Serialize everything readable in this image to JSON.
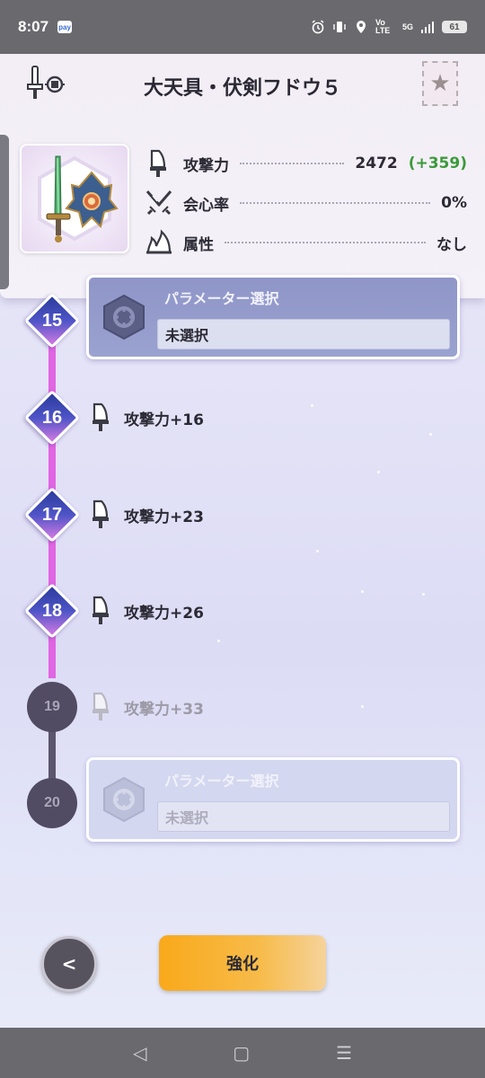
{
  "status_bar": {
    "time": "8:07",
    "app_badge": "pay",
    "network": "Vo LTE",
    "signal": "5G",
    "battery": "61"
  },
  "header": {
    "title": "大天具・伏剣フドウ５",
    "favorite_icon": "star-icon",
    "stats": [
      {
        "label": "攻撃力",
        "value": "2472",
        "bonus": "(+359)",
        "icon": "sword-blade-icon"
      },
      {
        "label": "会心率",
        "value": "0%",
        "icon": "crossed-swords-icon"
      },
      {
        "label": "属性",
        "value": "なし",
        "icon": "element-flame-icon"
      }
    ]
  },
  "timeline": {
    "levels": [
      {
        "level": "15",
        "type": "param",
        "title": "パラメーター選択",
        "value": "未選択",
        "state": "active"
      },
      {
        "level": "16",
        "type": "stat",
        "label": "攻撃力+16",
        "state": "active"
      },
      {
        "level": "17",
        "type": "stat",
        "label": "攻撃力+23",
        "state": "active"
      },
      {
        "level": "18",
        "type": "stat",
        "label": "攻撃力+26",
        "state": "active"
      },
      {
        "level": "19",
        "type": "stat",
        "label": "攻撃力+33",
        "state": "locked"
      },
      {
        "level": "20",
        "type": "param",
        "title": "パラメーター選択",
        "value": "未選択",
        "state": "locked"
      }
    ]
  },
  "buttons": {
    "back": "<",
    "enhance": "強化"
  },
  "colors": {
    "accent_pink": "#e066e3",
    "enhance_orange": "#f9a91a",
    "bonus_green": "#3a9a3a"
  }
}
